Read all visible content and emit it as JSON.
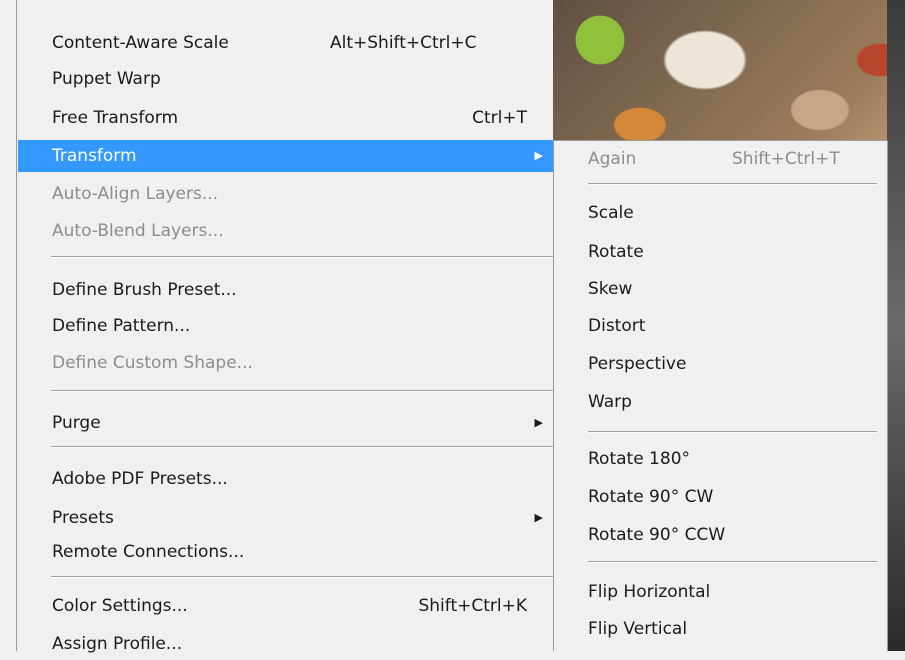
{
  "menu": {
    "items": [
      {
        "label": "Content-Aware Scale",
        "shortcut": "Alt+Shift+Ctrl+C"
      },
      {
        "label": "Puppet Warp"
      },
      {
        "label": "Free Transform",
        "shortcut": "Ctrl+T"
      },
      {
        "label": "Transform",
        "state": "highlighted"
      },
      {
        "label": "Auto-Align Layers...",
        "state": "disabled"
      },
      {
        "label": "Auto-Blend Layers...",
        "state": "disabled"
      },
      {
        "label": "Define Brush Preset..."
      },
      {
        "label": "Define Pattern..."
      },
      {
        "label": "Define Custom Shape...",
        "state": "disabled"
      },
      {
        "label": "Purge"
      },
      {
        "label": "Adobe PDF Presets..."
      },
      {
        "label": "Presets"
      },
      {
        "label": "Remote Connections..."
      },
      {
        "label": "Color Settings...",
        "shortcut": "Shift+Ctrl+K"
      },
      {
        "label": "Assign Profile..."
      }
    ]
  },
  "submenu": {
    "items": [
      {
        "label": "Again",
        "shortcut": "Shift+Ctrl+T",
        "state": "disabled"
      },
      {
        "label": "Scale"
      },
      {
        "label": "Rotate"
      },
      {
        "label": "Skew"
      },
      {
        "label": "Distort"
      },
      {
        "label": "Perspective"
      },
      {
        "label": "Warp"
      },
      {
        "label": "Rotate 180°"
      },
      {
        "label": "Rotate 90° CW"
      },
      {
        "label": "Rotate 90° CCW"
      },
      {
        "label": "Flip Horizontal"
      },
      {
        "label": "Flip Vertical"
      }
    ]
  },
  "icons": {
    "submenu_arrow": "triangle-right-icon"
  },
  "colors": {
    "highlight": "#3399ff",
    "menu_bg": "#f0f0f0",
    "disabled_text": "#8d8d8d"
  }
}
